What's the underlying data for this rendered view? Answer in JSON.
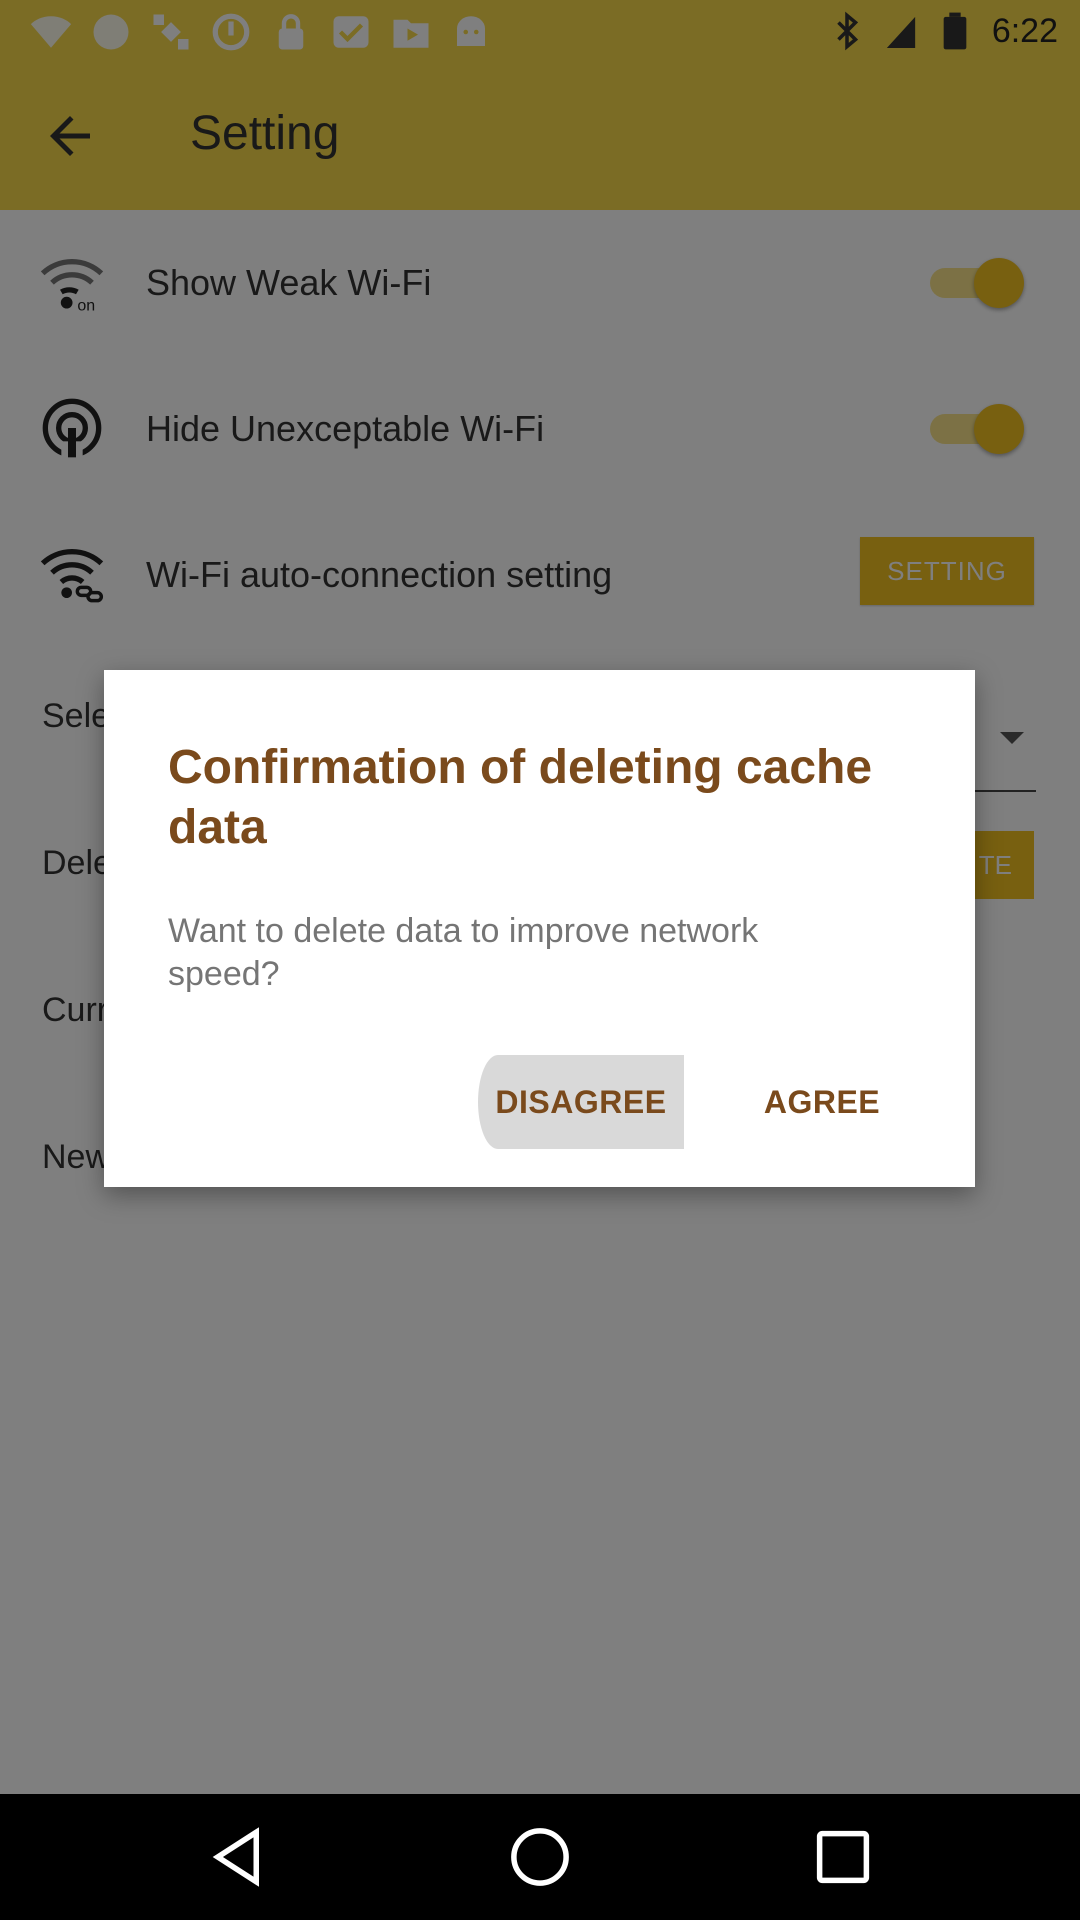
{
  "status_bar": {
    "time": "6:22",
    "left_icons": [
      "wifi-question-icon",
      "pinwheel-icon",
      "satellite-icon",
      "sync-icon",
      "lock-icon",
      "check-box-icon",
      "play-box-icon",
      "android-icon"
    ],
    "right_icons": [
      "bluetooth-icon",
      "signal-icon",
      "battery-icon"
    ]
  },
  "app_bar": {
    "title": "Setting"
  },
  "settings": {
    "show_weak_wifi": {
      "label": "Show Weak Wi-Fi",
      "enabled": true
    },
    "hide_unexceptable_wifi": {
      "label": "Hide Unexceptable Wi-Fi",
      "enabled": true
    },
    "auto_connection": {
      "label": "Wi-Fi auto-connection setting",
      "button": "SETTING"
    },
    "partial_labels": [
      "Sele",
      "Dele",
      "Curr",
      "New"
    ],
    "delete_button_partial": "TE"
  },
  "dialog": {
    "title": "Confirmation of deleting cache data",
    "message": "Want to delete data to improve network speed?",
    "disagree_label": "DISAGREE",
    "agree_label": "AGREE"
  },
  "colors": {
    "accent": "#F0C020",
    "app_bar": "#F6D94A",
    "dialog_title": "#7A4A1C"
  }
}
